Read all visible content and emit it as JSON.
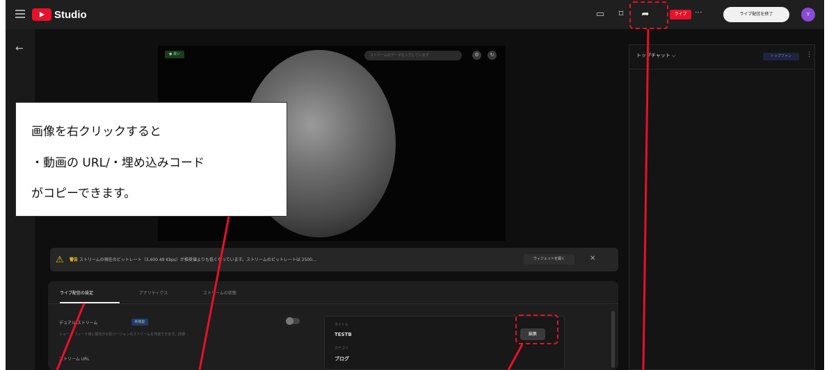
{
  "app": {
    "logo_text": "Studio",
    "live_badge": "ライブ",
    "live_status": "•••",
    "end_stream_button": "ライブ配信を終了",
    "avatar_letter": "Y"
  },
  "player": {
    "status_badge": "● 良い",
    "toolbar_placeholder": "ストリームのデータを入力しています"
  },
  "chat": {
    "title": "トップチャット ⌵",
    "chip": "トップファン",
    "more": "⋮"
  },
  "warning": {
    "label": "警告",
    "text": "ストリームの現在のビットレート（3,400.49 Kbps）が推奨値よりも低くなっています。ストリームのビットレートは 2500…",
    "open_button": "ウィジェットを開く",
    "close": "✕"
  },
  "tabs": [
    {
      "label": "ライブ配信の設定"
    },
    {
      "label": "アナリティクス"
    },
    {
      "label": "ストリームの状態"
    }
  ],
  "settings": {
    "dual_stream_label": "デュアル ストリーム",
    "beta_badge": "新機能",
    "dual_stream_desc": "ショート フィード用に縦向きの別バージョンのストリームを作成できます。詳細",
    "stream_url_label": "ストリーム URL"
  },
  "info_card": {
    "title_label": "タイトル",
    "title_value": "TESTB",
    "category_label": "カテゴリ",
    "category_value": "ブログ",
    "edit_button": "編集"
  },
  "callout": {
    "line1": "画像を右クリックすると",
    "line2": "・動画の URL/・埋め込みコード",
    "line3": "がコピーできます。"
  },
  "icons": [
    "menu-icon",
    "back-arrow-icon",
    "chat-window-icon",
    "bookmark-icon",
    "share-icon",
    "settings-icon",
    "warning-icon",
    "close-icon"
  ],
  "colors": {
    "annotation_red": "#e8102a",
    "warning_yellow": "#f2c21b",
    "avatar_purple": "#8a4bd6"
  }
}
